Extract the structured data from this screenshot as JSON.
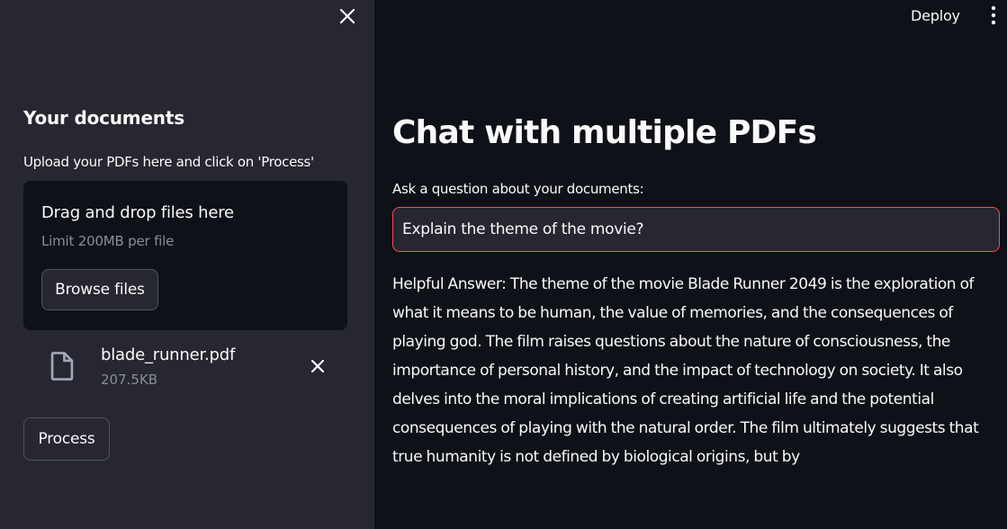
{
  "sidebar": {
    "close_icon": "close-icon",
    "title": "Your documents",
    "upload_label": "Upload your PDFs here and click on 'Process'",
    "dropzone": {
      "title": "Drag and drop files here",
      "limit": "Limit 200MB per file",
      "browse_label": "Browse files"
    },
    "files": [
      {
        "icon": "file-icon",
        "name": "blade_runner.pdf",
        "size": "207.5KB"
      }
    ],
    "process_label": "Process"
  },
  "header": {
    "deploy_label": "Deploy",
    "menu_icon": "more-vertical-icon"
  },
  "main": {
    "title": "Chat with multiple PDFs",
    "question_label": "Ask a question about your documents:",
    "question_value": "Explain the theme of the movie?",
    "answer": "Helpful Answer: The theme of the movie Blade Runner 2049 is the exploration of what it means to be human, the value of memories, and the consequences of playing god. The film raises questions about the nature of consciousness, the importance of personal history, and the impact of technology on society. It also delves into the moral implications of creating artificial life and the potential consequences of playing with the natural order. The film ultimately suggests that true humanity is not defined by biological origins, but by"
  },
  "colors": {
    "main_bg": "#0e1117",
    "sidebar_bg": "#262730",
    "text": "#fafafa",
    "muted_text": "#8b8d98",
    "input_focus_border": "#ff4b4b"
  }
}
